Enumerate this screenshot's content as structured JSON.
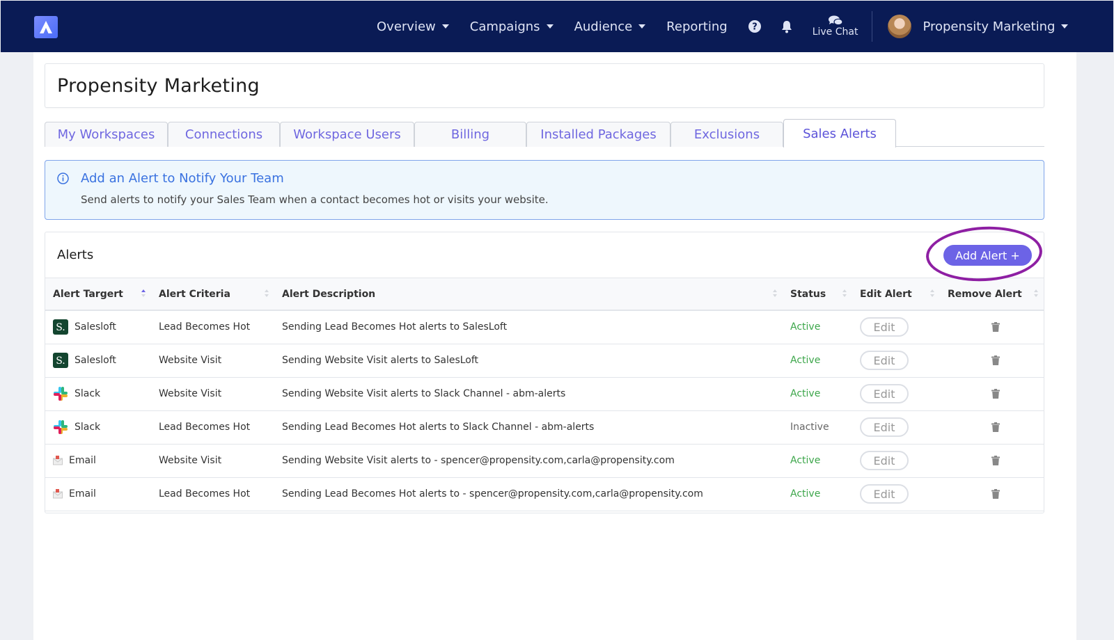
{
  "nav": {
    "items": [
      {
        "label": "Overview",
        "dropdown": true
      },
      {
        "label": "Campaigns",
        "dropdown": true
      },
      {
        "label": "Audience",
        "dropdown": true
      },
      {
        "label": "Reporting",
        "dropdown": false
      }
    ],
    "live_chat_label": "Live Chat",
    "user_name": "Propensity Marketing"
  },
  "page": {
    "title": "Propensity Marketing",
    "tabs": [
      {
        "label": "My Workspaces"
      },
      {
        "label": "Connections"
      },
      {
        "label": "Workspace Users"
      },
      {
        "label": "Billing"
      },
      {
        "label": "Installed Packages"
      },
      {
        "label": "Exclusions"
      },
      {
        "label": "Sales Alerts",
        "active": true
      }
    ]
  },
  "info": {
    "title": "Add an Alert to Notify Your Team",
    "text": "Send alerts to notify your Sales Team when a contact becomes hot or visits your website."
  },
  "alerts": {
    "title": "Alerts",
    "add_button": "Add Alert +",
    "columns": [
      "Alert Targert",
      "Alert Criteria",
      "Alert Description",
      "Status",
      "Edit Alert",
      "Remove Alert"
    ],
    "rows": [
      {
        "target": "Salesloft",
        "icon": "salesloft-icon",
        "criteria": "Lead Becomes Hot",
        "description": "Sending Lead Becomes Hot alerts to SalesLoft",
        "status": "Active",
        "edit": "Edit"
      },
      {
        "target": "Salesloft",
        "icon": "salesloft-icon",
        "criteria": "Website Visit",
        "description": "Sending Website Visit alerts to SalesLoft",
        "status": "Active",
        "edit": "Edit"
      },
      {
        "target": "Slack",
        "icon": "slack-icon",
        "criteria": "Website Visit",
        "description": "Sending Website Visit alerts to Slack Channel - abm-alerts",
        "status": "Active",
        "edit": "Edit"
      },
      {
        "target": "Slack",
        "icon": "slack-icon",
        "criteria": "Lead Becomes Hot",
        "description": "Sending Lead Becomes Hot alerts to Slack Channel - abm-alerts",
        "status": "Inactive",
        "edit": "Edit"
      },
      {
        "target": "Email",
        "icon": "email-icon",
        "criteria": "Website Visit",
        "description": "Sending Website Visit alerts to - spencer@propensity.com,carla@propensity.com",
        "status": "Active",
        "edit": "Edit"
      },
      {
        "target": "Email",
        "icon": "email-icon",
        "criteria": "Lead Becomes Hot",
        "description": "Sending Lead Becomes Hot alerts to - spencer@propensity.com,carla@propensity.com",
        "status": "Active",
        "edit": "Edit"
      }
    ]
  },
  "colors": {
    "nav_bg": "#0a1b55",
    "accent": "#6c63e6",
    "active_status": "#3ca64a",
    "highlight": "#8e1fa3"
  }
}
